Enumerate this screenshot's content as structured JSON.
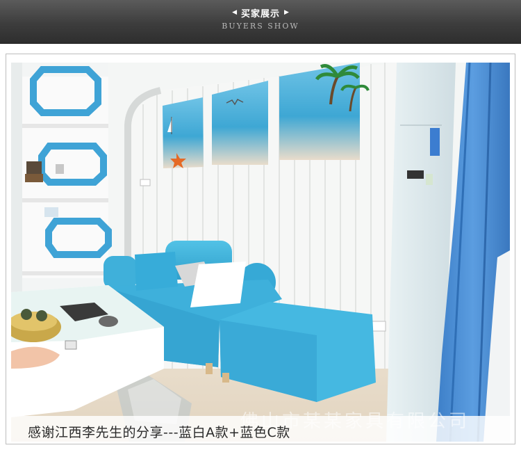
{
  "header": {
    "title": "买家展示",
    "subtitle": "BUYERS SHOW",
    "left_arrow": "◀",
    "right_arrow": "▶"
  },
  "photo": {
    "caption": "感谢江西李先生的分享---蓝白A款+蓝色C款",
    "watermark": "佛山市某某家具有限公司"
  },
  "colors": {
    "banner": "#3d3d3d",
    "sofa": "#41b6dc",
    "curtain": "#4a8fd6",
    "wall": "#f3f5f4",
    "shelf": "#3fa3d6"
  }
}
